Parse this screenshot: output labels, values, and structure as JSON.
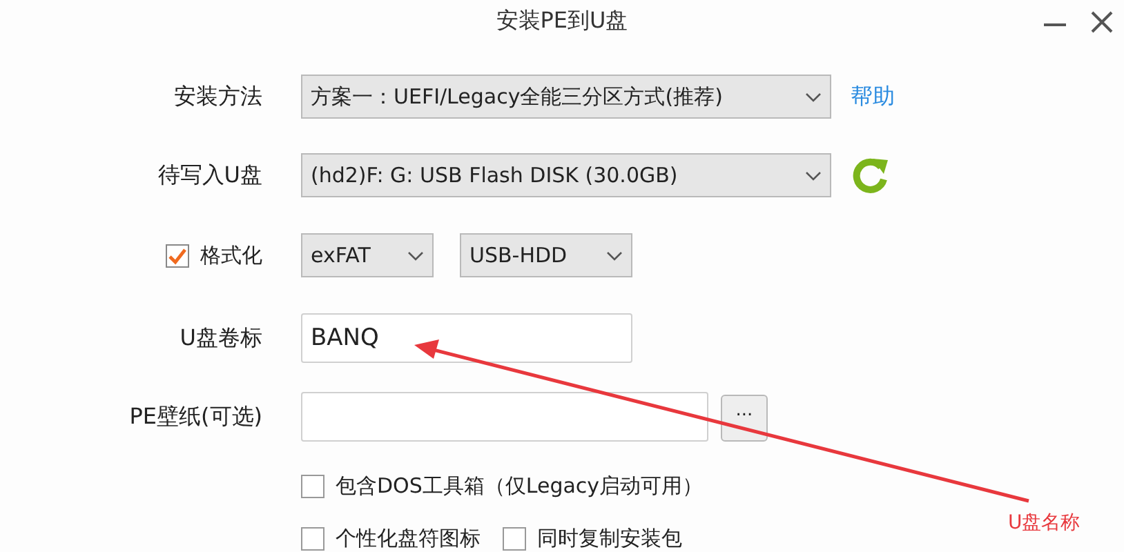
{
  "window": {
    "title": "安装PE到U盘"
  },
  "install_method": {
    "label": "安装方法",
    "value": "方案一：UEFI/Legacy全能三分区方式(推荐)"
  },
  "help_link": "帮助",
  "target_disk": {
    "label": "待写入U盘",
    "value": "(hd2)F: G: USB Flash DISK (30.0GB)"
  },
  "format": {
    "label": "格式化",
    "checked": true,
    "filesystem": "exFAT",
    "mode": "USB-HDD"
  },
  "volume_label": {
    "label": "U盘卷标",
    "value": "BANQ"
  },
  "wallpaper": {
    "label": "PE壁纸(可选)",
    "browse_button": "..."
  },
  "option_rows": [
    [
      {
        "label": "包含DOS工具箱（仅Legacy启动可用）",
        "checked": false
      }
    ],
    [
      {
        "label": "个性化盘符图标",
        "checked": false
      },
      {
        "label": "同时复制安装包",
        "checked": false
      }
    ]
  ],
  "annotation": {
    "text": "U盘名称"
  }
}
